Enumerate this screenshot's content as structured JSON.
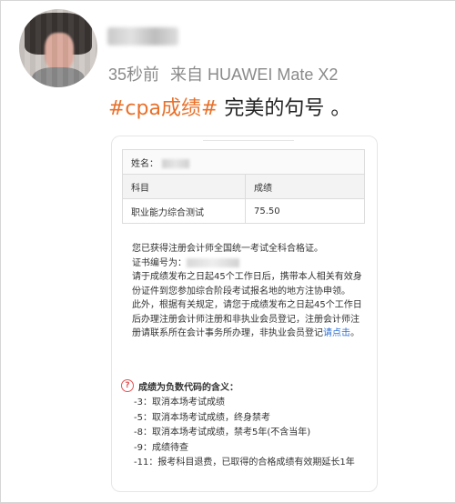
{
  "post": {
    "time": "35秒前",
    "source": "来自 HUAWEI Mate X2",
    "hashtag": "#cpa成绩#",
    "text": " 完美的句号 。"
  },
  "card": {
    "name_label": "姓名：",
    "table_header": {
      "subject": "科目",
      "score": "成绩"
    },
    "table_row": {
      "subject": "职业能力综合测试",
      "score": "75.50"
    },
    "para1": "您已获得注册会计师全国统一考试全科合格证。",
    "cert_label": "证书编号为：",
    "para2": "请于成绩发布之日起45个工作日后，携带本人相关有效身份证件到您参加综合阶段考试报名地的地方注协申领。",
    "para3_a": "此外，根据有关规定，请您于成绩发布之日起45个工作日后办理注册会计师注册和非执业会员登记，注册会计师注册请联系所在会计事务所办理，非执业会员登记",
    "para3_link": "请点击",
    "para3_end": "。",
    "neg_title": "成绩为负数代码的含义：",
    "neg_items": [
      "-3：取消本场考试成绩",
      "-5：取消本场考试成绩，终身禁考",
      "-8：取消本场考试成绩，禁考5年(不含当年)",
      "-9：成绩待查",
      "-11：报考科目退费，已取得的合格成绩有效期延长1年"
    ]
  },
  "colors": {
    "hashtag": "#e8702a",
    "meta": "#8a8a8a",
    "link": "#2f6fd1",
    "warn": "#e25555"
  },
  "icons": {
    "question": "question-circle-icon"
  }
}
